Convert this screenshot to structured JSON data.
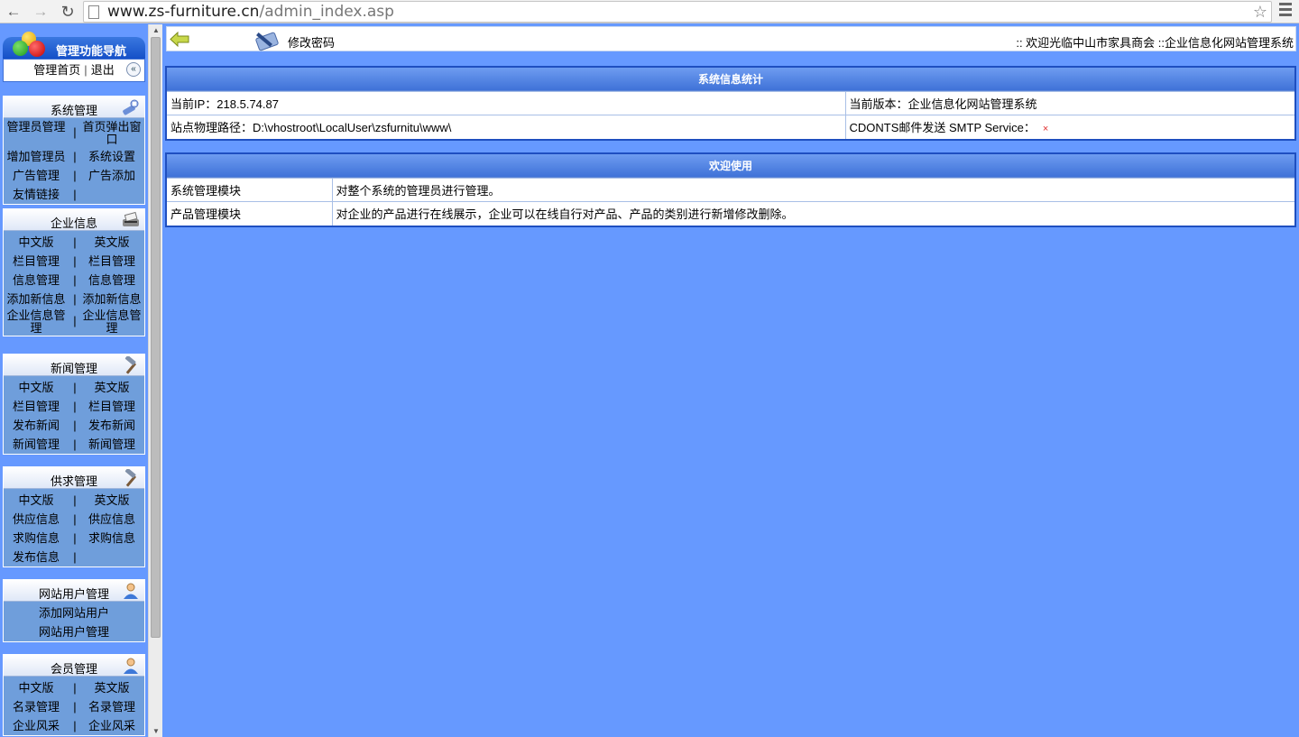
{
  "browser": {
    "url_host": "www.zs-furniture.cn",
    "url_path": "/admin_index.asp"
  },
  "nav": {
    "title": "管理功能导航",
    "home_link": "管理首页",
    "separator": "|",
    "logout_link": "退出",
    "collapse_glyph": "«"
  },
  "sections": {
    "system": {
      "title": "系统管理",
      "icon": "tools-icon",
      "rows": [
        [
          "管理员管理",
          "首页弹出窗口"
        ],
        [
          "增加管理员",
          "系统设置"
        ],
        [
          "广告管理",
          "广告添加"
        ],
        [
          "友情链接",
          ""
        ]
      ]
    },
    "company": {
      "title": "企业信息",
      "icon": "printer-icon",
      "rows": [
        [
          "中文版",
          "英文版"
        ],
        [
          "栏目管理",
          "栏目管理"
        ],
        [
          "信息管理",
          "信息管理"
        ],
        [
          "添加新信息",
          "添加新信息"
        ],
        [
          "企业信息管理",
          "企业信息管理"
        ]
      ]
    },
    "news": {
      "title": "新闻管理",
      "icon": "hammer-icon",
      "rows": [
        [
          "中文版",
          "英文版"
        ],
        [
          "栏目管理",
          "栏目管理"
        ],
        [
          "发布新闻",
          "发布新闻"
        ],
        [
          "新闻管理",
          "新闻管理"
        ]
      ]
    },
    "supply": {
      "title": "供求管理",
      "icon": "hammer-icon",
      "rows": [
        [
          "中文版",
          "英文版"
        ],
        [
          "供应信息",
          "供应信息"
        ],
        [
          "求购信息",
          "求购信息"
        ],
        [
          "发布信息",
          ""
        ]
      ]
    },
    "users": {
      "title": "网站用户管理",
      "icon": "user-icon",
      "rows": [
        "添加网站用户",
        "网站用户管理"
      ]
    },
    "members": {
      "title": "会员管理",
      "icon": "user-icon",
      "rows": [
        [
          "中文版",
          "英文版"
        ],
        [
          "名录管理",
          "名录管理"
        ],
        [
          "企业风采",
          "企业风采"
        ]
      ]
    }
  },
  "topbar": {
    "change_password": "修改密码",
    "welcome": ":: 欢迎光临中山市家具商会 ::企业信息化网站管理系统"
  },
  "system_info": {
    "title": "系统信息统计",
    "ip_label": "当前IP：",
    "ip_value": "218.5.74.87",
    "version_label": "当前版本：",
    "version_value": "企业信息化网站管理系统",
    "path_label": "站点物理路径：",
    "path_value": "D:\\vhostroot\\LocalUser\\zsfurnitu\\www\\",
    "cdonts_label": "CDONTS邮件发送 SMTP Service：",
    "cdonts_status": "×"
  },
  "welcome_panel": {
    "title": "欢迎使用",
    "rows": [
      {
        "module": "系统管理模块",
        "desc": "对整个系统的管理员进行管理。"
      },
      {
        "module": "产品管理模块",
        "desc": "对企业的产品进行在线展示，企业可以在线自行对产品、产品的类别进行新增修改删除。"
      }
    ]
  },
  "colors": {
    "page_bg": "#6699ff",
    "panel_border": "#1f4fc0",
    "nav_head": "#1550c8",
    "status_error": "#e03030"
  }
}
